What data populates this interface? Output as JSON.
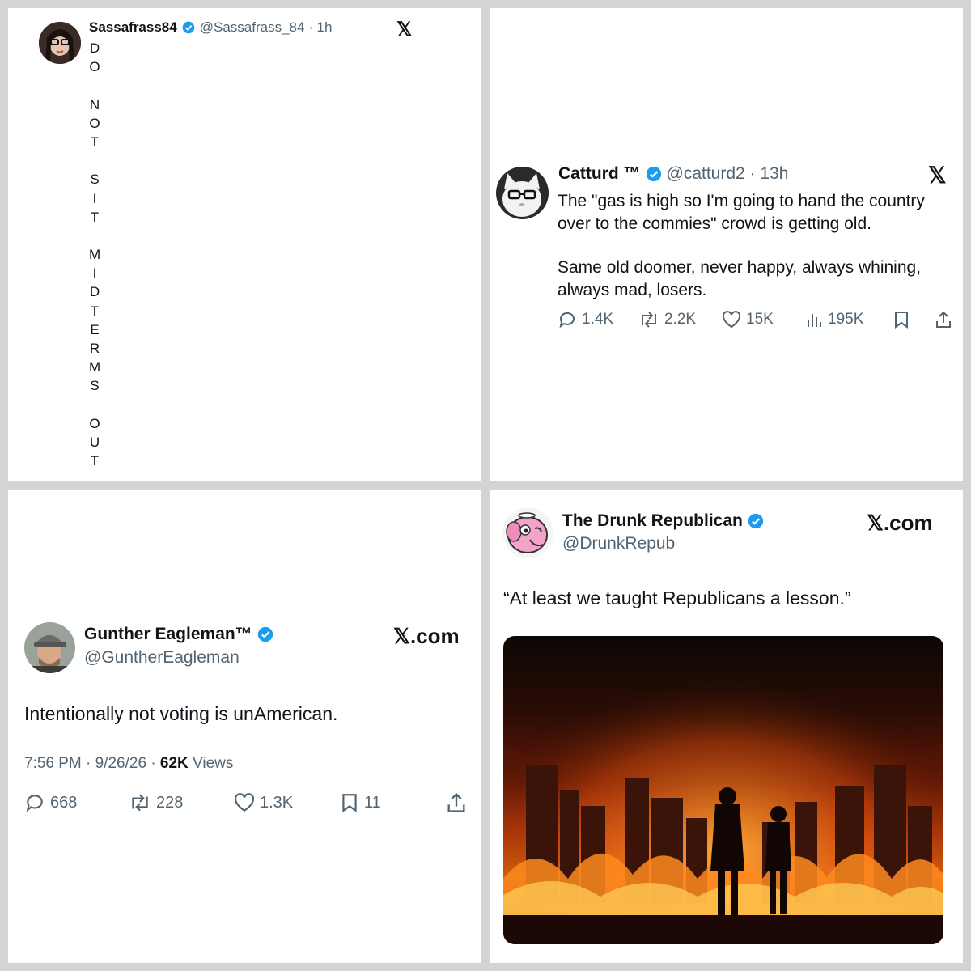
{
  "panels": {
    "sassafrass": {
      "display_name": "Sassafrass84",
      "meta": "@Sassafrass_84 · 1h",
      "x_logo": "𝕏",
      "vertical_text": [
        "D",
        "O",
        "",
        "N",
        "O",
        "T",
        "",
        "S",
        "I",
        "T",
        "",
        "M",
        "I",
        "D",
        "T",
        "E",
        "R",
        "M",
        "S",
        "",
        "O",
        "U",
        "T"
      ],
      "avatar_icon": "avatar-woman-glasses"
    },
    "catturd": {
      "display_name": "Catturd ™",
      "meta": "@catturd2 · 13h",
      "x_logo": "𝕏",
      "text_line1": "The \"gas is high so I'm going to hand the country",
      "text_line2": "over to the commies\" crowd is getting old.",
      "text_line3": "Same old doomer, never happy, always whining,",
      "text_line4": "always mad, losers.",
      "replies": "1.4K",
      "reposts": "2.2K",
      "likes": "15K",
      "views": "195K",
      "avatar_icon": "avatar-cat-glasses"
    },
    "gunther": {
      "display_name": "Gunther Eagleman™",
      "handle": "@GuntherEagleman",
      "x_logo": "𝕏.com",
      "text": "Intentionally not voting is unAmerican.",
      "timestamp": "7:56 PM · 9/26/26 · ",
      "views_count": "62K",
      "views_label": " Views",
      "replies": "668",
      "reposts": "228",
      "likes": "1.3K",
      "bookmarks": "11",
      "avatar_icon": "avatar-man-cap"
    },
    "drunkrepub": {
      "display_name": "The Drunk Republican",
      "handle": "@DrunkRepub",
      "x_logo": "𝕏.com",
      "text": "“At least we taught Republicans a lesson.”",
      "avatar_icon": "avatar-pink-elephant",
      "image_description_icon": "burning-city-image"
    }
  },
  "colors": {
    "verified_blue": "#1d9bf0",
    "text": "#0f1419",
    "muted": "#536471",
    "border": "#d4d4d4"
  }
}
